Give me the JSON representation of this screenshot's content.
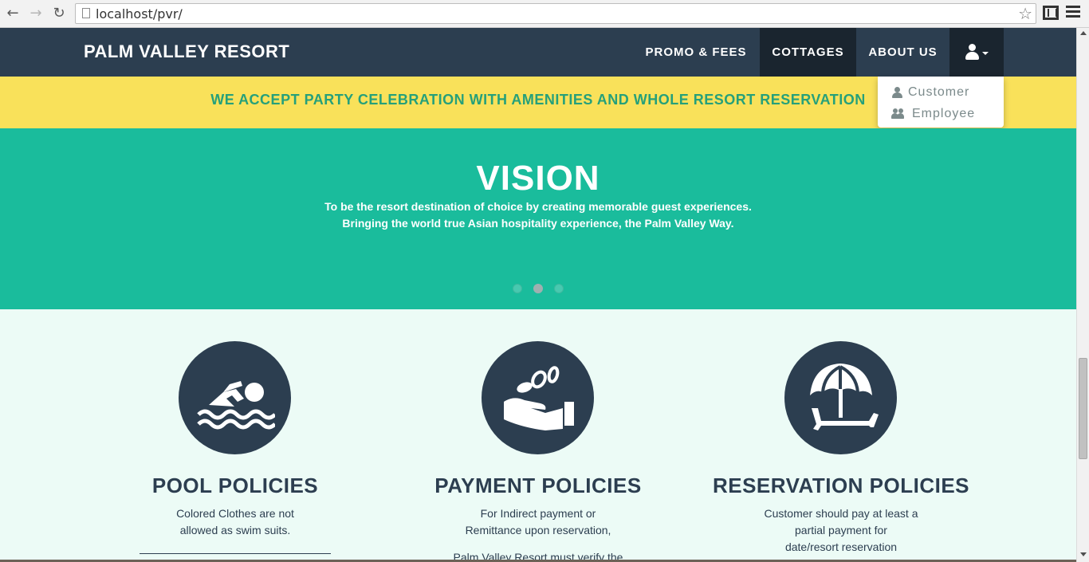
{
  "browser": {
    "url": "localhost/pvr/"
  },
  "navbar": {
    "brand": "PALM VALLEY RESORT",
    "items": [
      {
        "label": "PROMO & FEES"
      },
      {
        "label": "COTTAGES"
      },
      {
        "label": "ABOUT US"
      }
    ]
  },
  "dropdown": {
    "items": [
      {
        "label": "Customer",
        "icon": "user-icon"
      },
      {
        "label": "Employee",
        "icon": "users-icon"
      }
    ]
  },
  "banner": {
    "text": "WE ACCEPT PARTY CELEBRATION WITH AMENITIES AND WHOLE RESORT RESERVATION"
  },
  "hero": {
    "title": "VISION",
    "line1": "To be the resort destination of choice by creating memorable guest experiences.",
    "line2": "Bringing the world true Asian hospitality experience, the Palm Valley Way.",
    "active_slide": 2,
    "slide_count": 3
  },
  "policies": [
    {
      "title": "POOL POLICIES",
      "icon": "swimmer-icon",
      "lines": [
        "Colored Clothes are not",
        "allowed as swim suits."
      ]
    },
    {
      "title": "PAYMENT POLICIES",
      "icon": "payment-hand-icon",
      "lines": [
        "For Indirect payment or",
        "Remittance upon reservation,"
      ],
      "partial": "Palm Valley Resort must verify the"
    },
    {
      "title": "RESERVATION POLICIES",
      "icon": "beach-umbrella-icon",
      "lines": [
        "Customer should pay at least a",
        "partial payment for",
        "date/resort reservation"
      ]
    }
  ],
  "colors": {
    "navbar": "#2c3e50",
    "navbar_active": "#1a252f",
    "banner": "#f9e15a",
    "banner_text": "#26a07a",
    "hero": "#1abc9c",
    "section_bg": "#ecfbf6",
    "policy_circle": "#2c3e50"
  }
}
